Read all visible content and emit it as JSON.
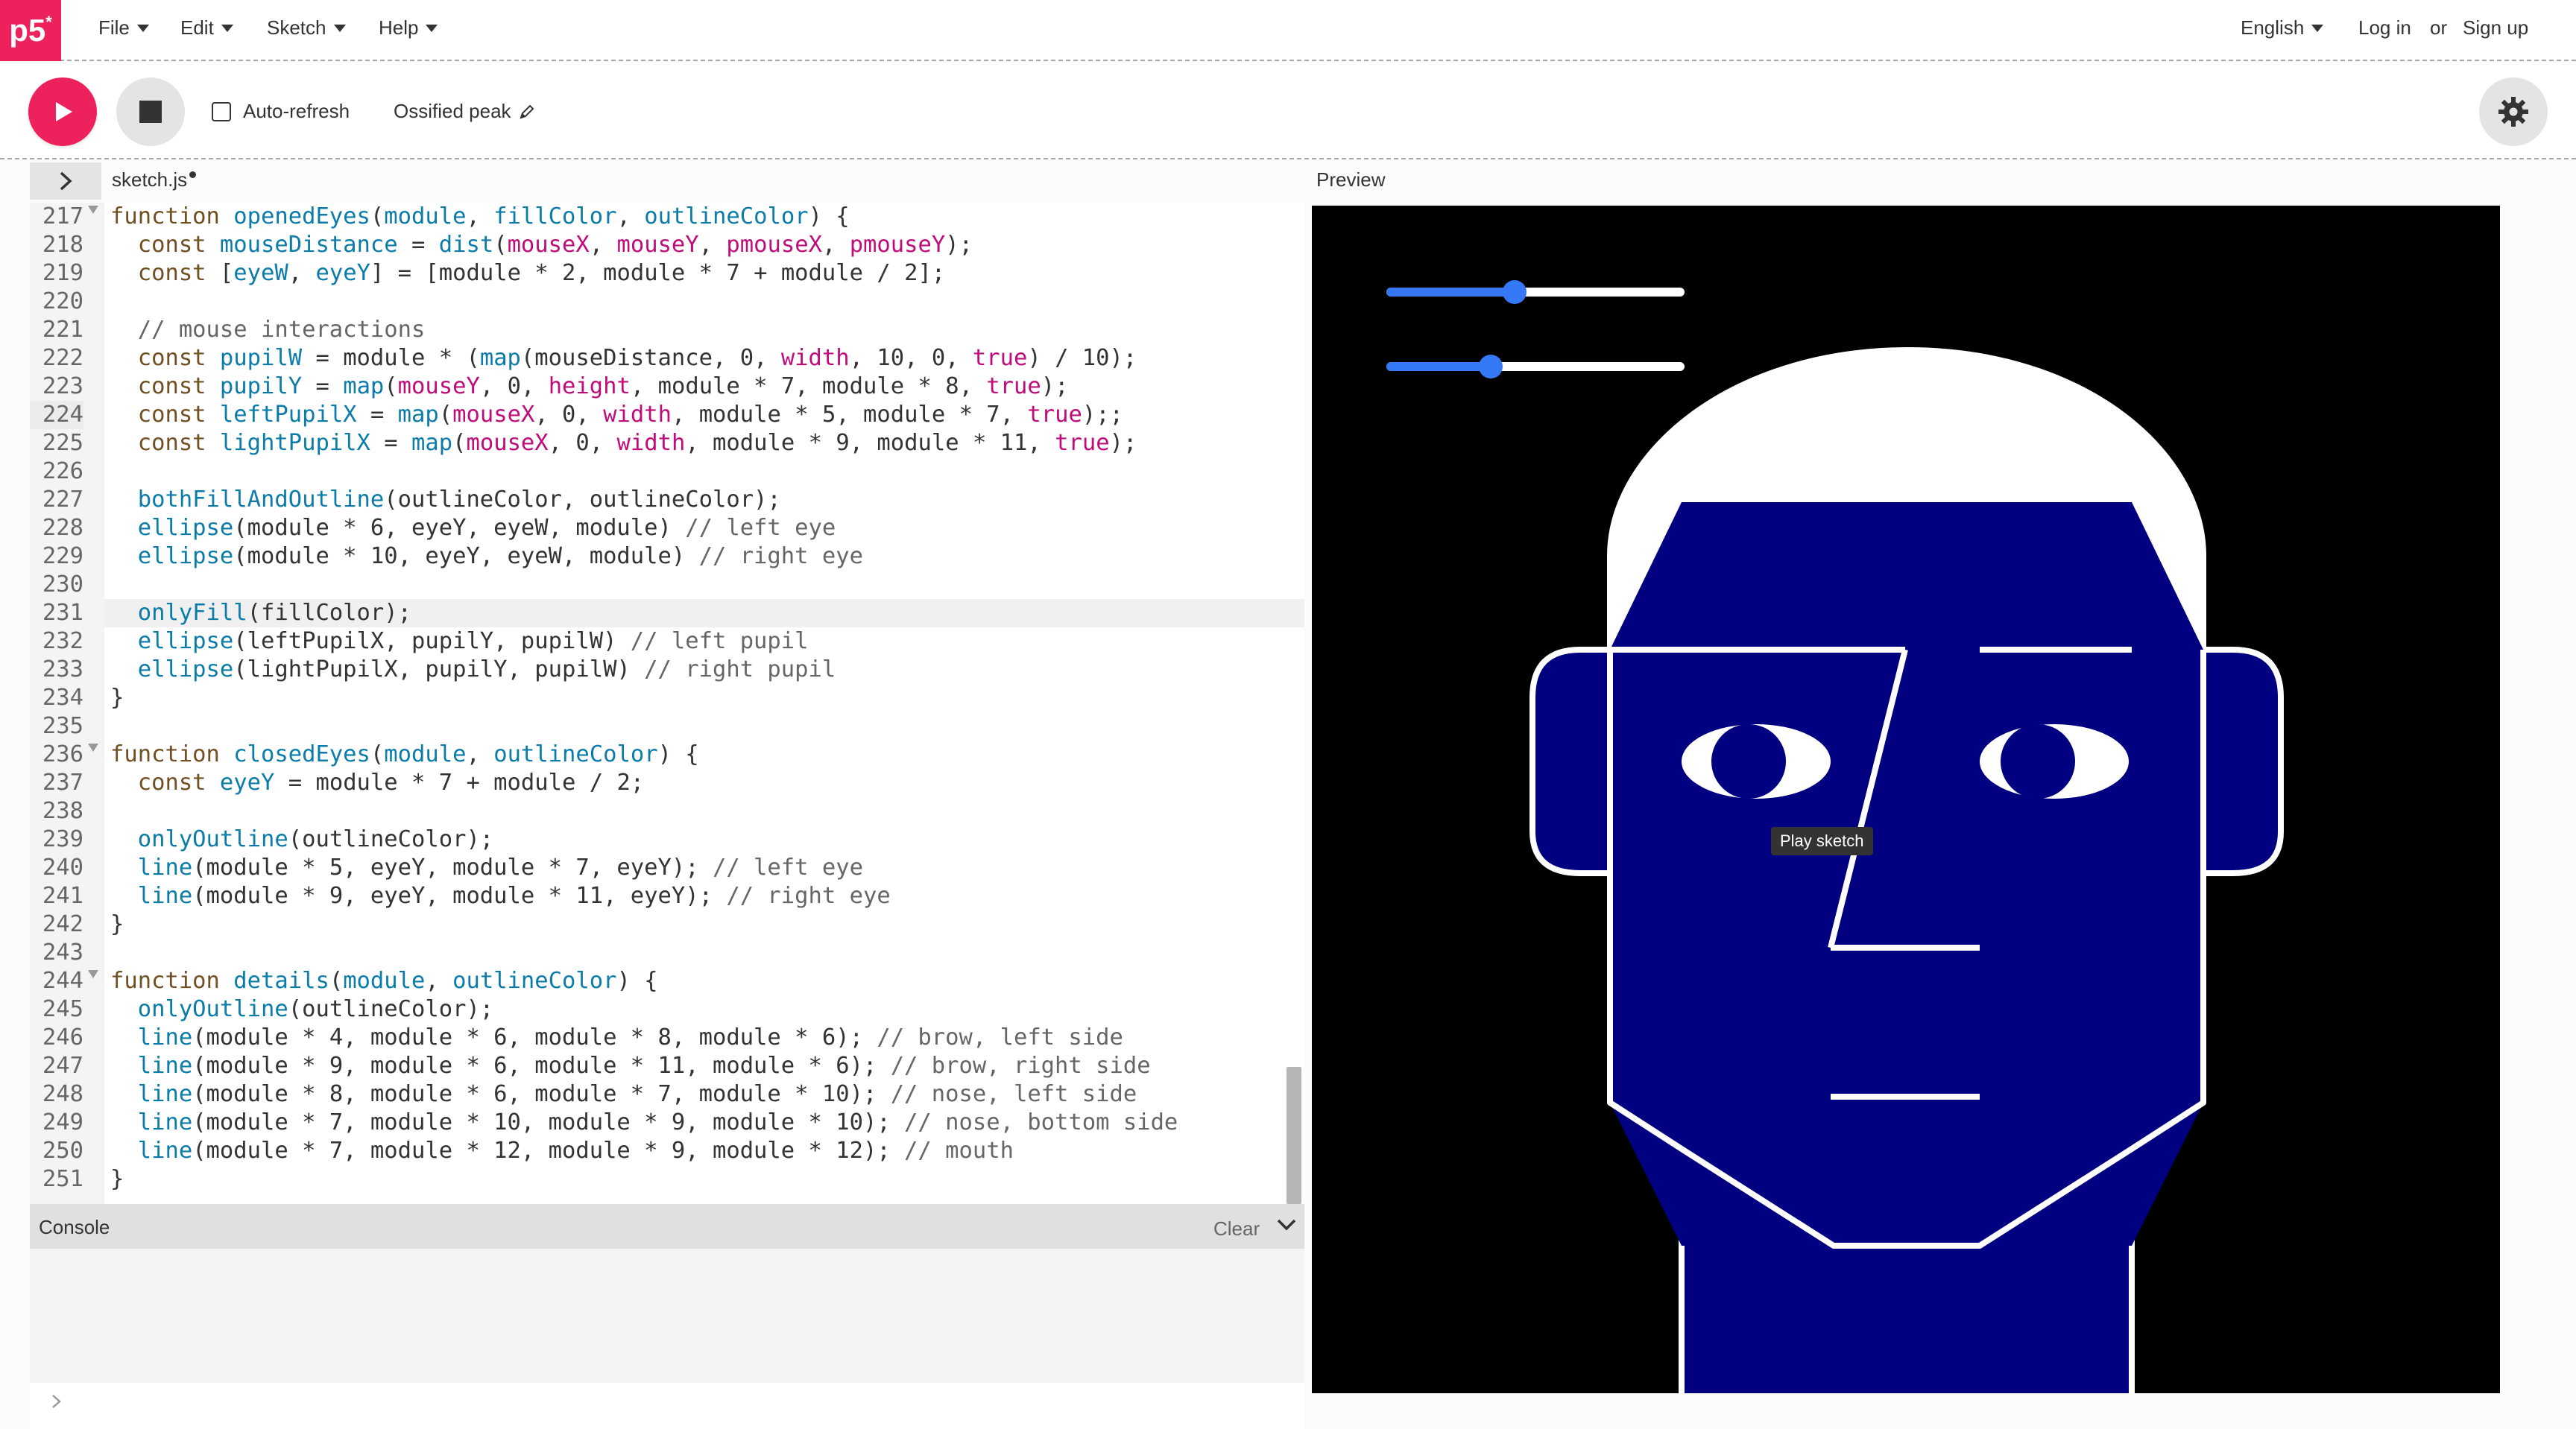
{
  "nav": {
    "logo": "p5",
    "logo_mark": "*",
    "menus": [
      "File",
      "Edit",
      "Sketch",
      "Help"
    ],
    "language": "English",
    "login": "Log in",
    "or": "or",
    "signup": "Sign up"
  },
  "toolbar": {
    "auto_refresh_label": "Auto-refresh",
    "auto_refresh_checked": false,
    "sketch_name": "Ossified peak"
  },
  "editor": {
    "tab": "sketch.js",
    "preview_label": "Preview",
    "active_line": 224,
    "highlighted_line": 231,
    "lines": [
      {
        "n": "217",
        "fold": true,
        "tokens": [
          [
            "kw",
            "function "
          ],
          [
            "fn",
            "openedEyes"
          ],
          [
            "",
            "("
          ],
          [
            "fn",
            "module"
          ],
          [
            "",
            ", "
          ],
          [
            "fn",
            "fillColor"
          ],
          [
            "",
            ", "
          ],
          [
            "fn",
            "outlineColor"
          ],
          [
            "",
            ") {"
          ]
        ]
      },
      {
        "n": "218",
        "tokens": [
          [
            "",
            "  "
          ],
          [
            "kw",
            "const "
          ],
          [
            "fn",
            "mouseDistance"
          ],
          [
            "",
            " = "
          ],
          [
            "fn",
            "dist"
          ],
          [
            "",
            "("
          ],
          [
            "pr",
            "mouseX"
          ],
          [
            "",
            ", "
          ],
          [
            "pr",
            "mouseY"
          ],
          [
            "",
            ", "
          ],
          [
            "pr",
            "pmouseX"
          ],
          [
            "",
            ", "
          ],
          [
            "pr",
            "pmouseY"
          ],
          [
            "",
            ");"
          ]
        ]
      },
      {
        "n": "219",
        "tokens": [
          [
            "",
            "  "
          ],
          [
            "kw",
            "const "
          ],
          [
            "",
            "["
          ],
          [
            "fn",
            "eyeW"
          ],
          [
            "",
            ", "
          ],
          [
            "fn",
            "eyeY"
          ],
          [
            "",
            "] = [module * 2, module * 7 + module / 2];"
          ]
        ]
      },
      {
        "n": "220",
        "tokens": []
      },
      {
        "n": "221",
        "tokens": [
          [
            "",
            "  "
          ],
          [
            "cm",
            "// mouse interactions"
          ]
        ]
      },
      {
        "n": "222",
        "tokens": [
          [
            "",
            "  "
          ],
          [
            "kw",
            "const "
          ],
          [
            "fn",
            "pupilW"
          ],
          [
            "",
            " = module * ("
          ],
          [
            "fn",
            "map"
          ],
          [
            "",
            "(mouseDistance, 0, "
          ],
          [
            "pr",
            "width"
          ],
          [
            "",
            ", 10, 0, "
          ],
          [
            "pr",
            "true"
          ],
          [
            "",
            ") / 10);"
          ]
        ]
      },
      {
        "n": "223",
        "tokens": [
          [
            "",
            "  "
          ],
          [
            "kw",
            "const "
          ],
          [
            "fn",
            "pupilY"
          ],
          [
            "",
            " = "
          ],
          [
            "fn",
            "map"
          ],
          [
            "",
            "("
          ],
          [
            "pr",
            "mouseY"
          ],
          [
            "",
            ", 0, "
          ],
          [
            "pr",
            "height"
          ],
          [
            "",
            ", module * 7, module * 8, "
          ],
          [
            "pr",
            "true"
          ],
          [
            "",
            ");"
          ]
        ]
      },
      {
        "n": "224",
        "tokens": [
          [
            "",
            "  "
          ],
          [
            "kw",
            "const "
          ],
          [
            "fn",
            "leftPupilX"
          ],
          [
            "",
            " = "
          ],
          [
            "fn",
            "map"
          ],
          [
            "",
            "("
          ],
          [
            "pr",
            "mouseX"
          ],
          [
            "",
            ", 0, "
          ],
          [
            "pr",
            "width"
          ],
          [
            "",
            ", module * 5, module * 7, "
          ],
          [
            "pr",
            "true"
          ],
          [
            "",
            ");;"
          ]
        ]
      },
      {
        "n": "225",
        "tokens": [
          [
            "",
            "  "
          ],
          [
            "kw",
            "const "
          ],
          [
            "fn",
            "lightPupilX"
          ],
          [
            "",
            " = "
          ],
          [
            "fn",
            "map"
          ],
          [
            "",
            "("
          ],
          [
            "pr",
            "mouseX"
          ],
          [
            "",
            ", 0, "
          ],
          [
            "pr",
            "width"
          ],
          [
            "",
            ", module * 9, module * 11, "
          ],
          [
            "pr",
            "true"
          ],
          [
            "",
            ");"
          ]
        ]
      },
      {
        "n": "226",
        "tokens": []
      },
      {
        "n": "227",
        "tokens": [
          [
            "",
            "  "
          ],
          [
            "fn",
            "bothFillAndOutline"
          ],
          [
            "",
            "(outlineColor, outlineColor);"
          ]
        ]
      },
      {
        "n": "228",
        "tokens": [
          [
            "",
            "  "
          ],
          [
            "fn",
            "ellipse"
          ],
          [
            "",
            "(module * 6, eyeY, eyeW, module) "
          ],
          [
            "cm",
            "// left eye"
          ]
        ]
      },
      {
        "n": "229",
        "tokens": [
          [
            "",
            "  "
          ],
          [
            "fn",
            "ellipse"
          ],
          [
            "",
            "(module * 10, eyeY, eyeW, module) "
          ],
          [
            "cm",
            "// right eye"
          ]
        ]
      },
      {
        "n": "230",
        "tokens": []
      },
      {
        "n": "231",
        "tokens": [
          [
            "",
            "  "
          ],
          [
            "fn",
            "onlyFill"
          ],
          [
            "",
            "(fillColor);"
          ]
        ]
      },
      {
        "n": "232",
        "tokens": [
          [
            "",
            "  "
          ],
          [
            "fn",
            "ellipse"
          ],
          [
            "",
            "(leftPupilX, pupilY, pupilW) "
          ],
          [
            "cm",
            "// left pupil"
          ]
        ]
      },
      {
        "n": "233",
        "tokens": [
          [
            "",
            "  "
          ],
          [
            "fn",
            "ellipse"
          ],
          [
            "",
            "(lightPupilX, pupilY, pupilW) "
          ],
          [
            "cm",
            "// right pupil"
          ]
        ]
      },
      {
        "n": "234",
        "tokens": [
          [
            "",
            "}"
          ]
        ]
      },
      {
        "n": "235",
        "tokens": []
      },
      {
        "n": "236",
        "fold": true,
        "tokens": [
          [
            "kw",
            "function "
          ],
          [
            "fn",
            "closedEyes"
          ],
          [
            "",
            "("
          ],
          [
            "fn",
            "module"
          ],
          [
            "",
            ", "
          ],
          [
            "fn",
            "outlineColor"
          ],
          [
            "",
            ") {"
          ]
        ]
      },
      {
        "n": "237",
        "tokens": [
          [
            "",
            "  "
          ],
          [
            "kw",
            "const "
          ],
          [
            "fn",
            "eyeY"
          ],
          [
            "",
            " = module * 7 + module / 2;"
          ]
        ]
      },
      {
        "n": "238",
        "tokens": []
      },
      {
        "n": "239",
        "tokens": [
          [
            "",
            "  "
          ],
          [
            "fn",
            "onlyOutline"
          ],
          [
            "",
            "(outlineColor);"
          ]
        ]
      },
      {
        "n": "240",
        "tokens": [
          [
            "",
            "  "
          ],
          [
            "fn",
            "line"
          ],
          [
            "",
            "(module * 5, eyeY, module * 7, eyeY); "
          ],
          [
            "cm",
            "// left eye"
          ]
        ]
      },
      {
        "n": "241",
        "tokens": [
          [
            "",
            "  "
          ],
          [
            "fn",
            "line"
          ],
          [
            "",
            "(module * 9, eyeY, module * 11, eyeY); "
          ],
          [
            "cm",
            "// right eye"
          ]
        ]
      },
      {
        "n": "242",
        "tokens": [
          [
            "",
            "}"
          ]
        ]
      },
      {
        "n": "243",
        "tokens": []
      },
      {
        "n": "244",
        "fold": true,
        "tokens": [
          [
            "kw",
            "function "
          ],
          [
            "fn",
            "details"
          ],
          [
            "",
            "("
          ],
          [
            "fn",
            "module"
          ],
          [
            "",
            ", "
          ],
          [
            "fn",
            "outlineColor"
          ],
          [
            "",
            ") {"
          ]
        ]
      },
      {
        "n": "245",
        "tokens": [
          [
            "",
            "  "
          ],
          [
            "fn",
            "onlyOutline"
          ],
          [
            "",
            "(outlineColor);"
          ]
        ]
      },
      {
        "n": "246",
        "tokens": [
          [
            "",
            "  "
          ],
          [
            "fn",
            "line"
          ],
          [
            "",
            "(module * 4, module * 6, module * 8, module * 6); "
          ],
          [
            "cm",
            "// brow, left side"
          ]
        ]
      },
      {
        "n": "247",
        "tokens": [
          [
            "",
            "  "
          ],
          [
            "fn",
            "line"
          ],
          [
            "",
            "(module * 9, module * 6, module * 11, module * 6); "
          ],
          [
            "cm",
            "// brow, right side"
          ]
        ]
      },
      {
        "n": "248",
        "tokens": [
          [
            "",
            "  "
          ],
          [
            "fn",
            "line"
          ],
          [
            "",
            "(module * 8, module * 6, module * 7, module * 10); "
          ],
          [
            "cm",
            "// nose, left side"
          ]
        ]
      },
      {
        "n": "249",
        "tokens": [
          [
            "",
            "  "
          ],
          [
            "fn",
            "line"
          ],
          [
            "",
            "(module * 7, module * 10, module * 9, module * 10); "
          ],
          [
            "cm",
            "// nose, bottom side"
          ]
        ]
      },
      {
        "n": "250",
        "tokens": [
          [
            "",
            "  "
          ],
          [
            "fn",
            "line"
          ],
          [
            "",
            "(module * 7, module * 12, module * 9, module * 12); "
          ],
          [
            "cm",
            "// mouth"
          ]
        ]
      },
      {
        "n": "251",
        "tokens": [
          [
            "",
            "}"
          ]
        ]
      }
    ]
  },
  "console": {
    "title": "Console",
    "clear": "Clear"
  },
  "preview": {
    "tooltip": "Play sketch",
    "slider1_value": 0.43,
    "slider2_value": 0.35,
    "face_color": "#000080",
    "outline_color": "#ffffff",
    "background_color": "#000000"
  },
  "colors": {
    "accent": "#ed225d",
    "slider": "#3478f6"
  },
  "icons": {
    "play": "play-icon",
    "stop": "stop-icon",
    "settings": "gear-icon",
    "pencil": "pencil-icon",
    "chevron_right": "chevron-right-icon",
    "chevron_down": "chevron-down-icon"
  }
}
